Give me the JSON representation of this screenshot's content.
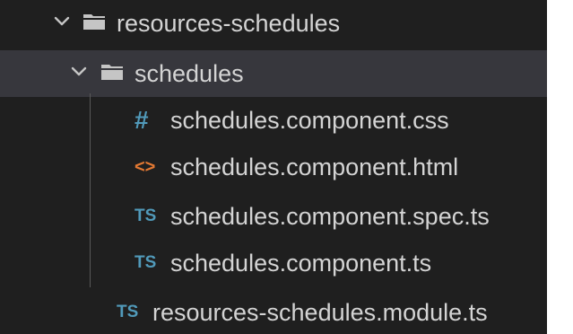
{
  "explorer": {
    "colors": {
      "background": "#1f1f1f",
      "selected_row": "#37373d",
      "text": "#d4d4d4",
      "css_icon": "#519aba",
      "html_icon": "#e37933",
      "ts_icon": "#519aba"
    },
    "tree": [
      {
        "type": "folder",
        "label": "resources-schedules",
        "expanded": true,
        "icon": "folder-icon",
        "chevron": "chevron-down-icon"
      },
      {
        "type": "folder",
        "label": "schedules",
        "expanded": true,
        "selected": true,
        "icon": "folder-icon",
        "chevron": "chevron-down-icon"
      },
      {
        "type": "file",
        "label": "schedules.component.css",
        "icon": "css-file-icon",
        "glyph": "#"
      },
      {
        "type": "file",
        "label": "schedules.component.html",
        "icon": "html-file-icon",
        "glyph": "<>"
      },
      {
        "type": "file",
        "label": "schedules.component.spec.ts",
        "icon": "typescript-file-icon",
        "glyph": "TS"
      },
      {
        "type": "file",
        "label": "schedules.component.ts",
        "icon": "typescript-file-icon",
        "glyph": "TS"
      },
      {
        "type": "file",
        "label": "resources-schedules.module.ts",
        "icon": "typescript-file-icon",
        "glyph": "TS"
      }
    ]
  }
}
